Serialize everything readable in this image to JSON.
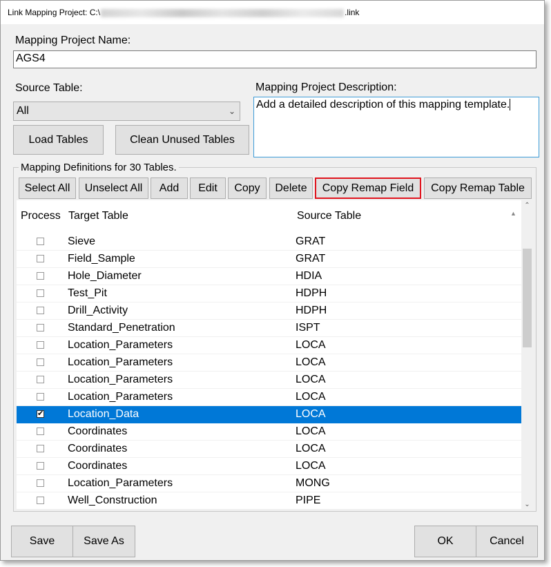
{
  "window": {
    "title_prefix": "Link Mapping Project: C:\\",
    "title_suffix": ".link"
  },
  "project_name": {
    "label": "Mapping Project Name:",
    "value": "AGS4"
  },
  "source_table": {
    "label": "Source Table:",
    "selected": "All"
  },
  "description": {
    "label": "Mapping Project Description:",
    "value": "Add a detailed description of this mapping template."
  },
  "buttons": {
    "load_tables": "Load Tables",
    "clean_unused": "Clean Unused Tables",
    "save": "Save",
    "save_as": "Save As",
    "ok": "OK",
    "cancel": "Cancel"
  },
  "mapping": {
    "group_label": "Mapping Definitions for 30 Tables.",
    "toolbar": {
      "select_all": "Select All",
      "unselect_all": "Unselect All",
      "add": "Add",
      "edit": "Edit",
      "copy": "Copy",
      "delete": "Delete",
      "copy_remap_field": "Copy Remap Field",
      "copy_remap_table": "Copy Remap Table"
    },
    "columns": {
      "process": "Process",
      "target": "Target Table",
      "source": "Source Table"
    },
    "rows": [
      {
        "checked": false,
        "target": "Sieve",
        "source": "GRAT"
      },
      {
        "checked": false,
        "target": "Field_Sample",
        "source": "GRAT"
      },
      {
        "checked": false,
        "target": "Hole_Diameter",
        "source": "HDIA"
      },
      {
        "checked": false,
        "target": "Test_Pit",
        "source": "HDPH"
      },
      {
        "checked": false,
        "target": "Drill_Activity",
        "source": "HDPH"
      },
      {
        "checked": false,
        "target": "Standard_Penetration",
        "source": "ISPT"
      },
      {
        "checked": false,
        "target": "Location_Parameters",
        "source": "LOCA"
      },
      {
        "checked": false,
        "target": "Location_Parameters",
        "source": "LOCA"
      },
      {
        "checked": false,
        "target": "Location_Parameters",
        "source": "LOCA"
      },
      {
        "checked": false,
        "target": "Location_Parameters",
        "source": "LOCA"
      },
      {
        "checked": true,
        "selected": true,
        "target": "Location_Data",
        "source": "LOCA"
      },
      {
        "checked": false,
        "target": "Coordinates",
        "source": "LOCA"
      },
      {
        "checked": false,
        "target": "Coordinates",
        "source": "LOCA"
      },
      {
        "checked": false,
        "target": "Coordinates",
        "source": "LOCA"
      },
      {
        "checked": false,
        "target": "Location_Parameters",
        "source": "MONG"
      },
      {
        "checked": false,
        "target": "Well_Construction",
        "source": "PIPE"
      }
    ]
  },
  "colors": {
    "selection": "#0078d7",
    "highlight_border": "#e0141e"
  }
}
